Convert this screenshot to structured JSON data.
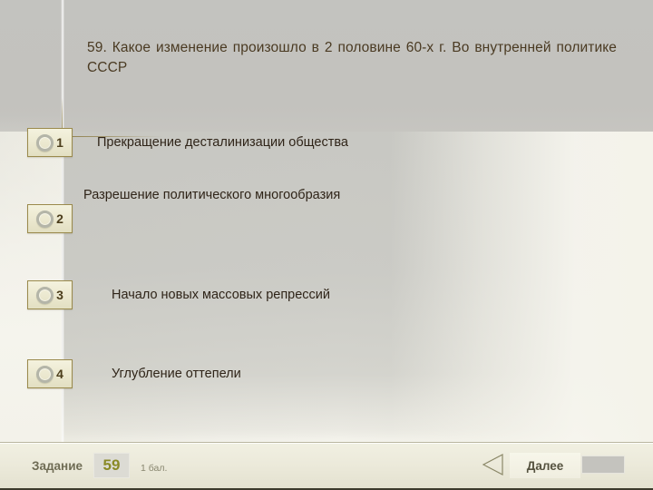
{
  "question": {
    "number": "59.",
    "text": "59. Какое изменение произошло в 2 половине 60-х г. Во внутренней политике СССР"
  },
  "options": [
    {
      "number": "1",
      "text": "Прекращение десталинизации общества"
    },
    {
      "number": "2",
      "text": "Разрешение политического многообразия"
    },
    {
      "number": "3",
      "text": "Начало новых массовых репрессий"
    },
    {
      "number": "4",
      "text": "Углубление оттепели"
    }
  ],
  "footer": {
    "task_label": "Задание",
    "task_number": "59",
    "points": "1 бал.",
    "prev_icon": "triangle-left-icon",
    "next_label": "Далее",
    "progress_bar": ""
  },
  "colors": {
    "header_band": "#c3c2be",
    "body_light": "#f4f3ec",
    "option_button_fill": "#ebe8cf",
    "option_button_border": "#9a8a4c",
    "option_ring": "#b4b5a8",
    "question_text": "#4a3a22",
    "option_text": "#2f2418",
    "footer_number": "#8a8a26",
    "footer_label": "#6f6c55",
    "connector_line": "#8c7c46"
  }
}
